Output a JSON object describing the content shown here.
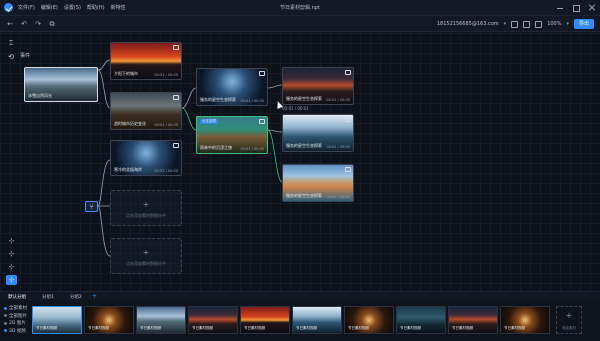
{
  "app": {
    "title": "节日素材剪辑.npt",
    "menu": [
      "文件(F)",
      "编辑(E)",
      "设置(S)",
      "帮助(H)",
      "新特性"
    ],
    "account": "18152156685@163.com",
    "zoom": "100%",
    "export_label": "导出"
  },
  "sidebar": {
    "event_label": "事件"
  },
  "nodes": [
    {
      "id": "n1",
      "label": "冰雪自然风光",
      "image": "mountain",
      "duration": "",
      "has_icon": false
    },
    {
      "id": "n2",
      "label": "夕阳下的城市",
      "image": "sunset",
      "duration": "00:01 / 00:05",
      "has_icon": true
    },
    {
      "id": "n3",
      "label": "战时城市历史变化",
      "image": "city",
      "duration": "00:01 / 00:05",
      "has_icon": true
    },
    {
      "id": "n4",
      "label": "服务的星空生态探索",
      "image": "storm",
      "duration": "00:01 / 00:05",
      "has_icon": true
    },
    {
      "id": "n5",
      "label": "雨林中的沉浸之旅",
      "image": "jungle",
      "duration": "00:01 / 00:05",
      "has_icon": true
    },
    {
      "id": "n6",
      "label": "服务的星空生态探索",
      "image": "volcano",
      "duration": "00:01 / 00:05",
      "has_icon": true
    },
    {
      "id": "n7",
      "label": "服务的星空生态探索",
      "image": "lake",
      "duration": "00:01 / 00:05",
      "has_icon": true
    },
    {
      "id": "n8",
      "label": "服务的星空生态探索",
      "image": "coast",
      "duration": "00:01 / 00:05",
      "has_icon": true
    },
    {
      "id": "n9",
      "label": "寒冷的北极海岸",
      "image": "storm",
      "duration": "00:01 / 00:05",
      "has_icon": true
    }
  ],
  "branch_tag": "分支选项",
  "empty_slot": {
    "plus": "+",
    "hint": "点击添加素材到镜头中"
  },
  "hover_tip": "00:01 / 00:01",
  "bottom_tabs": [
    "默认分组",
    "分组1",
    "分组2"
  ],
  "filters": [
    {
      "label": "全部素材",
      "on": true
    },
    {
      "label": "全部图片",
      "on": false
    },
    {
      "label": "2D 图片",
      "on": false
    },
    {
      "label": "3D 视频",
      "on": true
    }
  ],
  "thumbs": [
    {
      "label": "节日素材视频",
      "image": "ice"
    },
    {
      "label": "节日素材视频",
      "image": "cave"
    },
    {
      "label": "节日素材视频",
      "image": "mountain"
    },
    {
      "label": "节日素材视频",
      "image": "volcano"
    },
    {
      "label": "节日素材视频",
      "image": "sunset"
    },
    {
      "label": "节日素材视频",
      "image": "lake"
    },
    {
      "label": "节日素材视频",
      "image": "cave"
    },
    {
      "label": "节日素材视频",
      "image": "forest"
    },
    {
      "label": "节日素材视频",
      "image": "volcano"
    },
    {
      "label": "节日素材视频",
      "image": "cave"
    },
    {
      "label": "节日素材视频",
      "image": "forest"
    }
  ],
  "add_asset": {
    "plus": "+",
    "hint": "添加素材"
  },
  "icons": [
    "logo-icon",
    "back-icon",
    "undo-icon",
    "redo-icon",
    "crop-icon",
    "minimize-icon",
    "maximize-icon",
    "close-icon",
    "branch-icon",
    "zoom-in-icon",
    "zoom-out-icon",
    "fit-icon",
    "hand-icon"
  ]
}
